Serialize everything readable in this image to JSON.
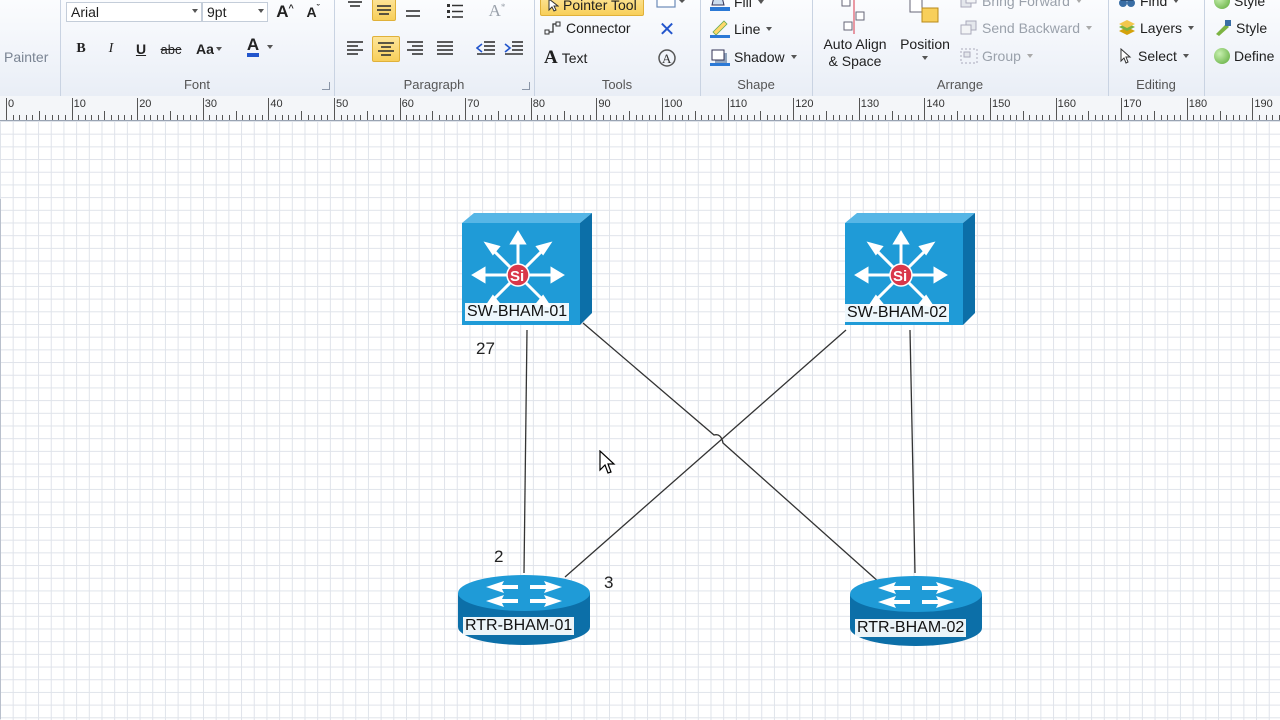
{
  "ribbon": {
    "clipboard": {
      "format_painter_label": "Painter"
    },
    "font": {
      "label": "Font",
      "font_name": "Arial",
      "font_size": "9pt",
      "bold": "B",
      "italic": "I",
      "underline": "U",
      "strikethrough": "abc",
      "change_case": "Aa",
      "font_color": "A"
    },
    "paragraph": {
      "label": "Paragraph"
    },
    "tools": {
      "label": "Tools",
      "pointer_tool": "Pointer Tool",
      "connector": "Connector",
      "text": "Text"
    },
    "shape": {
      "label": "Shape",
      "fill": "Fill",
      "line": "Line",
      "shadow": "Shadow"
    },
    "arrange": {
      "label": "Arrange",
      "auto_align_line1": "Auto Align",
      "auto_align_line2": "& Space",
      "position": "Position",
      "bring_forward": "Bring Forward",
      "send_backward": "Send Backward",
      "group": "Group"
    },
    "editing": {
      "label": "Editing",
      "find": "Find",
      "layers": "Layers",
      "select": "Select"
    },
    "styles": {
      "style1": "Style",
      "style2": "Style",
      "define": "Define"
    }
  },
  "ruler": {
    "labels": [
      "0",
      "10",
      "20",
      "30",
      "40",
      "50",
      "60",
      "70",
      "80",
      "90",
      "100",
      "110",
      "120",
      "130",
      "140",
      "150",
      "160",
      "170",
      "180",
      "190"
    ]
  },
  "diagram": {
    "devices": [
      {
        "type": "multilayer-switch",
        "label": "SW-BHAM-01"
      },
      {
        "type": "multilayer-switch",
        "label": "SW-BHAM-02"
      },
      {
        "type": "router",
        "label": "RTR-BHAM-01"
      },
      {
        "type": "router",
        "label": "RTR-BHAM-02"
      }
    ],
    "port_labels": {
      "sw1_port": "27",
      "rtr1_port_a": "2",
      "rtr1_port_b": "3"
    },
    "switch_badge": "Si"
  },
  "colors": {
    "device_blue": "#1f9bd7",
    "device_dark": "#0c6fa8",
    "badge_red": "#d9374a",
    "ribbon_active": "#f8cf5a"
  }
}
